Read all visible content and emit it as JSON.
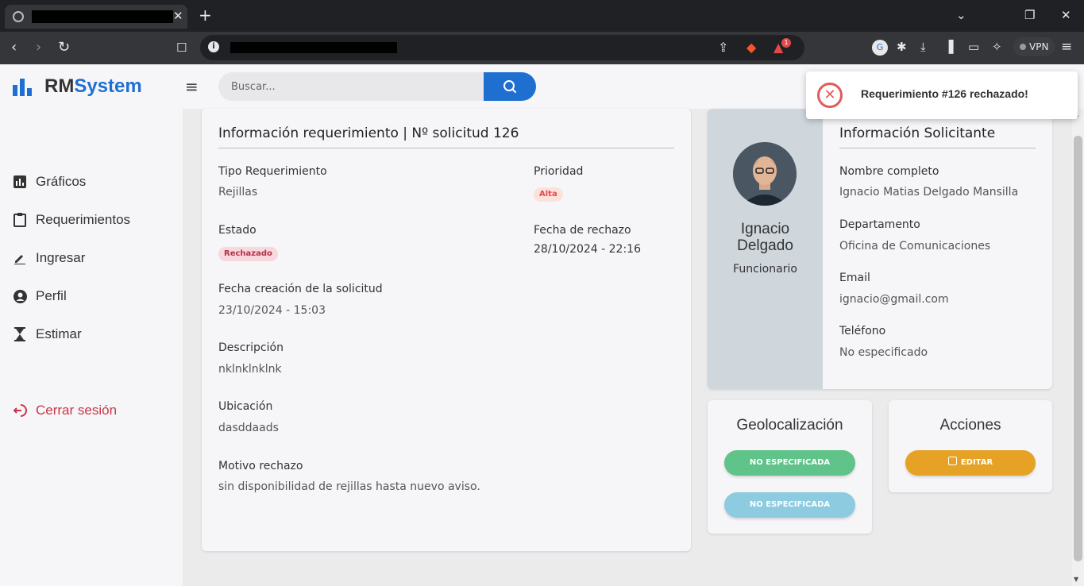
{
  "browser": {
    "new_tab_glyph": "+",
    "close_tab_glyph": "✕",
    "vpn_label": "VPN",
    "brave_badge": "1"
  },
  "app": {
    "logo_prefix": "RM",
    "logo_suffix": "System",
    "brand_color": "#1f6fd1"
  },
  "search": {
    "placeholder": "Buscar..."
  },
  "sidebar": {
    "items": [
      {
        "label": "Gráficos",
        "icon": "bar-chart-icon"
      },
      {
        "label": "Requerimientos",
        "icon": "clipboard-icon"
      },
      {
        "label": "Ingresar",
        "icon": "pencil-icon"
      },
      {
        "label": "Perfil",
        "icon": "user-circle-icon"
      },
      {
        "label": "Estimar",
        "icon": "hourglass-icon"
      }
    ],
    "logout": {
      "label": "Cerrar sesión",
      "icon": "logout-icon"
    }
  },
  "request": {
    "title": "Información requerimiento | Nº solicitud 126",
    "tipo_label": "Tipo Requerimiento",
    "tipo_value": "Rejillas",
    "prioridad_label": "Prioridad",
    "prioridad_value": "Alta",
    "estado_label": "Estado",
    "estado_value": "Rechazado",
    "fecha_rechazo_label": "Fecha de rechazo",
    "fecha_rechazo_value": "28/10/2024 - 22:16",
    "fecha_creacion_label": "Fecha creación de la solicitud",
    "fecha_creacion_value": "23/10/2024 - 15:03",
    "descripcion_label": "Descripción",
    "descripcion_value": "nklnklnklnk",
    "ubicacion_label": "Ubicación",
    "ubicacion_value": "dasddaads",
    "motivo_label": "Motivo rechazo",
    "motivo_value": "sin disponibilidad de rejillas hasta nuevo aviso."
  },
  "solicitante": {
    "first_name": "Ignacio",
    "last_name": "Delgado",
    "role": "Funcionario",
    "title": "Información Solicitante",
    "nombre_label": "Nombre completo",
    "nombre_value": "Ignacio Matias Delgado Mansilla",
    "departamento_label": "Departamento",
    "departamento_value": "Oficina de Comunicaciones",
    "email_label": "Email",
    "email_value": "ignacio@gmail.com",
    "telefono_label": "Teléfono",
    "telefono_value": "No especificado"
  },
  "geolocalizacion": {
    "title": "Geolocalización",
    "button1": "NO ESPECIFICADA",
    "button2": "NO ESPECIFICADA",
    "button1_color": "#5fc38a",
    "button2_color": "#8ccbe0"
  },
  "acciones": {
    "title": "Acciones",
    "edit_label": "EDITAR",
    "edit_color": "#e6a224"
  },
  "toast": {
    "message": "Requerimiento #126 rechazado!",
    "color": "#e25a5a"
  }
}
